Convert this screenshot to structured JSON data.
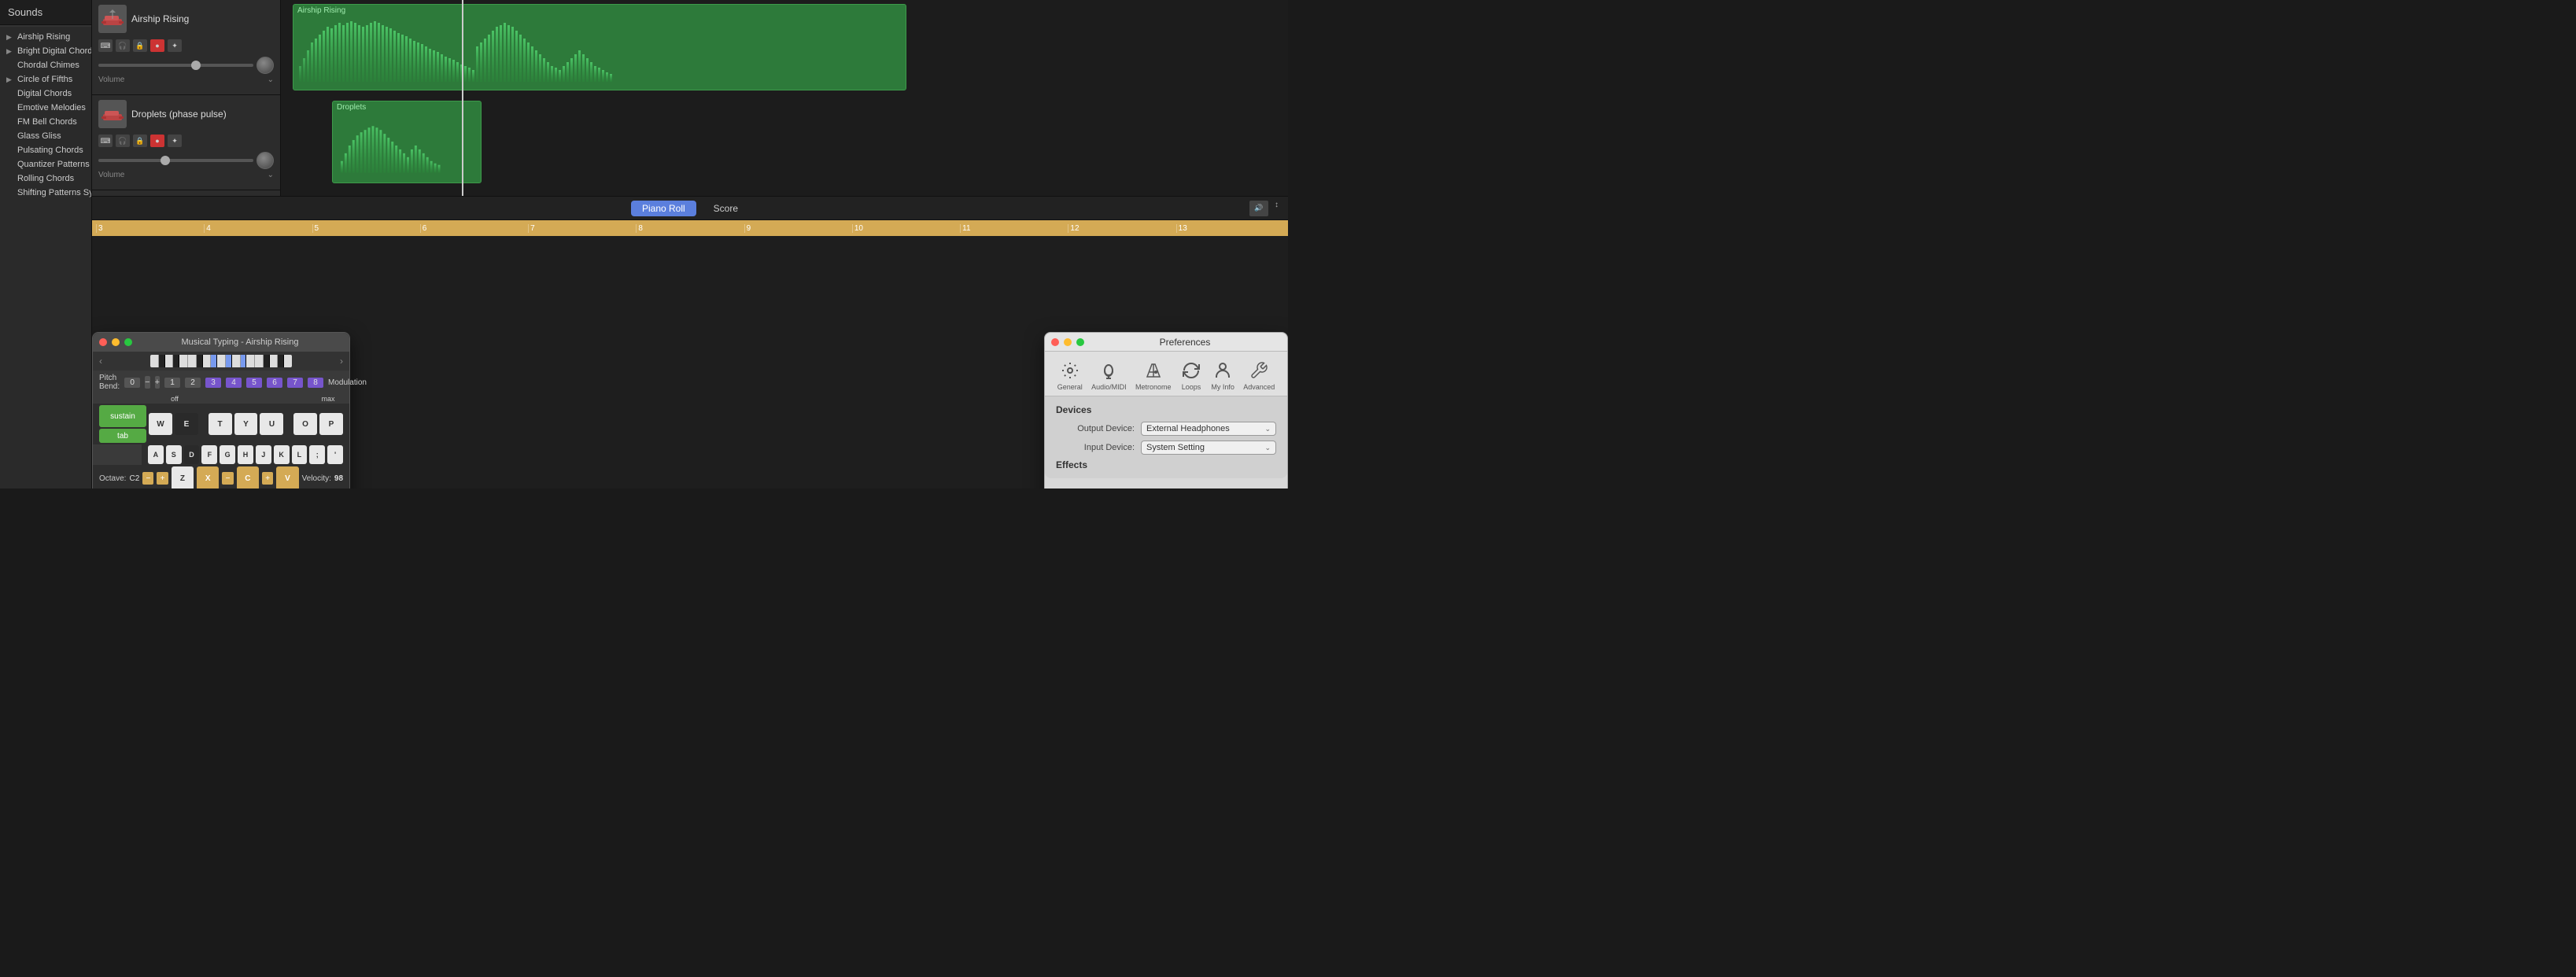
{
  "sidebar": {
    "title": "Sounds",
    "items": [
      {
        "id": "airship-rising",
        "label": "Airship Rising",
        "hasArrow": true,
        "expanded": false
      },
      {
        "id": "bright-digital-chords",
        "label": "Bright Digital Chords",
        "hasArrow": true,
        "expanded": false
      },
      {
        "id": "chordal-chimes",
        "label": "Chordal Chimes",
        "hasArrow": false,
        "expanded": false
      },
      {
        "id": "circle-of-fifths",
        "label": "Circle of Fifths",
        "hasArrow": true,
        "expanded": false
      },
      {
        "id": "digital-chords",
        "label": "Digital Chords",
        "hasArrow": false,
        "expanded": false
      },
      {
        "id": "emotive-melodies",
        "label": "Emotive Melodies",
        "hasArrow": false,
        "expanded": false
      },
      {
        "id": "fm-bell-chords",
        "label": "FM Bell Chords",
        "hasArrow": false,
        "expanded": false
      },
      {
        "id": "glass-gliss",
        "label": "Glass Gliss",
        "hasArrow": false,
        "expanded": false
      },
      {
        "id": "pulsating-chords",
        "label": "Pulsating Chords",
        "hasArrow": false,
        "expanded": false
      },
      {
        "id": "quantizer-patterns",
        "label": "Quantizer Patterns",
        "hasArrow": false,
        "expanded": false
      },
      {
        "id": "rolling-chords",
        "label": "Rolling Chords",
        "hasArrow": false,
        "expanded": false
      },
      {
        "id": "shifting-patterns",
        "label": "Shifting Patterns Synth",
        "hasArrow": false,
        "expanded": false
      }
    ]
  },
  "tracks": [
    {
      "id": "airship-rising",
      "name": "Airship Rising",
      "regionLabel": "Airship Rising",
      "regionColor": "#2d7a3a"
    },
    {
      "id": "droplets",
      "name": "Droplets (phase pulse)",
      "regionLabel": "Droplets",
      "regionColor": "#2d7a3a"
    }
  ],
  "piano_roll": {
    "tab_piano_roll": "Piano Roll",
    "tab_score": "Score",
    "ruler_marks": [
      "3",
      "4",
      "5",
      "6",
      "7",
      "8",
      "9",
      "10",
      "11",
      "12",
      "13"
    ]
  },
  "musical_typing": {
    "title": "Musical Typing - Airship Rising",
    "pitch_bend_label": "Pitch Bend:",
    "pitch_value": "0",
    "modulation_label": "Modulation",
    "octave_label": "Octave:",
    "octave_value": "C2",
    "velocity_label": "Velocity:",
    "velocity_value": "98",
    "keys_row1": [
      "1",
      "2",
      "3",
      "4",
      "5",
      "6",
      "7",
      "8"
    ],
    "keys_row1_colors": [
      "default",
      "default",
      "purple",
      "purple",
      "purple",
      "purple",
      "purple",
      "purple"
    ],
    "keys_row1_extra": [
      "off",
      "",
      "",
      "",
      "",
      "",
      "",
      "max"
    ],
    "sustain_label": "sustain",
    "tab_label": "tab",
    "white_keys": [
      "W",
      "E",
      "T",
      "Y",
      "U",
      "O",
      "P"
    ],
    "black_keys_row": [
      "A",
      "S",
      "D",
      "F",
      "G",
      "H",
      "J",
      "K",
      "L",
      ";",
      "'"
    ],
    "bottom_keys": [
      "Z",
      "X",
      "C",
      "V"
    ],
    "bottom_key_colors": [
      "default",
      "orange",
      "orange",
      "orange"
    ]
  },
  "preferences": {
    "title": "Preferences",
    "icons": [
      {
        "id": "general",
        "label": "General",
        "symbol": "⚙"
      },
      {
        "id": "audio-midi",
        "label": "Audio/MIDI",
        "symbol": "🎵"
      },
      {
        "id": "metronome",
        "label": "Metronome",
        "symbol": "🎼"
      },
      {
        "id": "loops",
        "label": "Loops",
        "symbol": "↺"
      },
      {
        "id": "my-info",
        "label": "My Info",
        "symbol": "👤"
      },
      {
        "id": "advanced",
        "label": "Advanced",
        "symbol": "🔧"
      }
    ],
    "section_title": "Devices",
    "output_device_label": "Output Device:",
    "output_device_value": "External Headphones",
    "input_device_label": "Input Device:",
    "input_device_value": "System Setting",
    "effects_title": "Effects"
  },
  "window_title": "Airship Rising"
}
